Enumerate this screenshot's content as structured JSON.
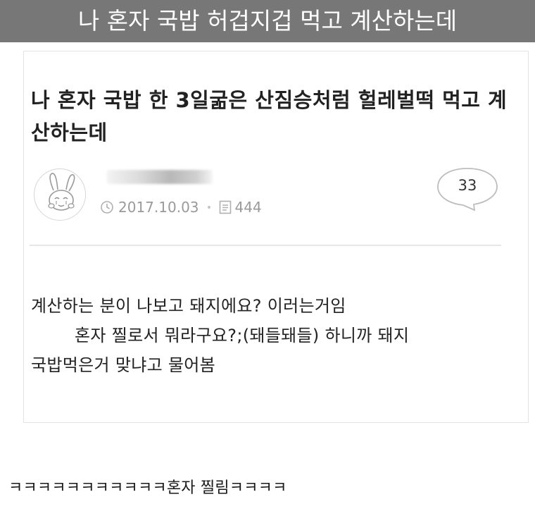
{
  "banner": {
    "text": "나 혼자 국밥 허겁지겁 먹고 계산하는데"
  },
  "post": {
    "title": "나 혼자 국밥 한 3일굶은 산짐승처럼 헐레벌떡 먹고 계산하는데",
    "author": {
      "avatar_icon": "bunny-avatar-icon"
    },
    "date": "2017.10.03",
    "views": "444",
    "comment_count": "33",
    "body": [
      "계산하는 분이 나보고 돼지에요? 이러는거임",
      "혼자 찔로서 뭐라구요?;(돼들돼들) 하니까 돼지",
      "국밥먹은거 맞냐고 물어봄"
    ]
  },
  "comment": {
    "text": "ㅋㅋㅋㅋㅋㅋㅋㅋㅋㅋㅋ혼자 찔림ㅋㅋㅋㅋ"
  },
  "colors": {
    "banner_bg": "#777777",
    "banner_text": "#ffffff",
    "meta_text": "#9a9a9a",
    "card_border": "#e2e2e2"
  }
}
